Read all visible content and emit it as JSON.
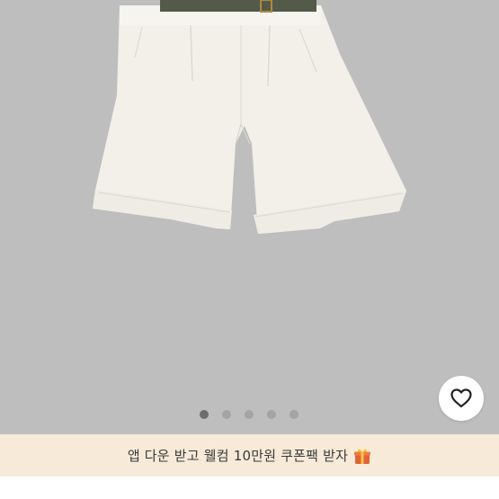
{
  "product_gallery": {
    "image_alt": "white pleated cuffed shorts with olive belt",
    "slide_count": 5,
    "active_slide": 1,
    "indicator_color": "#a4a4a4",
    "indicator_active_color": "#6d6d6d",
    "background_color": "#bebebe"
  },
  "wishlist": {
    "icon": "heart-outline-icon"
  },
  "promo_banner": {
    "text": "앱 다운 받고 웰컴 10만원 쿠폰팩 받자",
    "icon": "gift-icon",
    "background_color": "#f7ead8"
  }
}
